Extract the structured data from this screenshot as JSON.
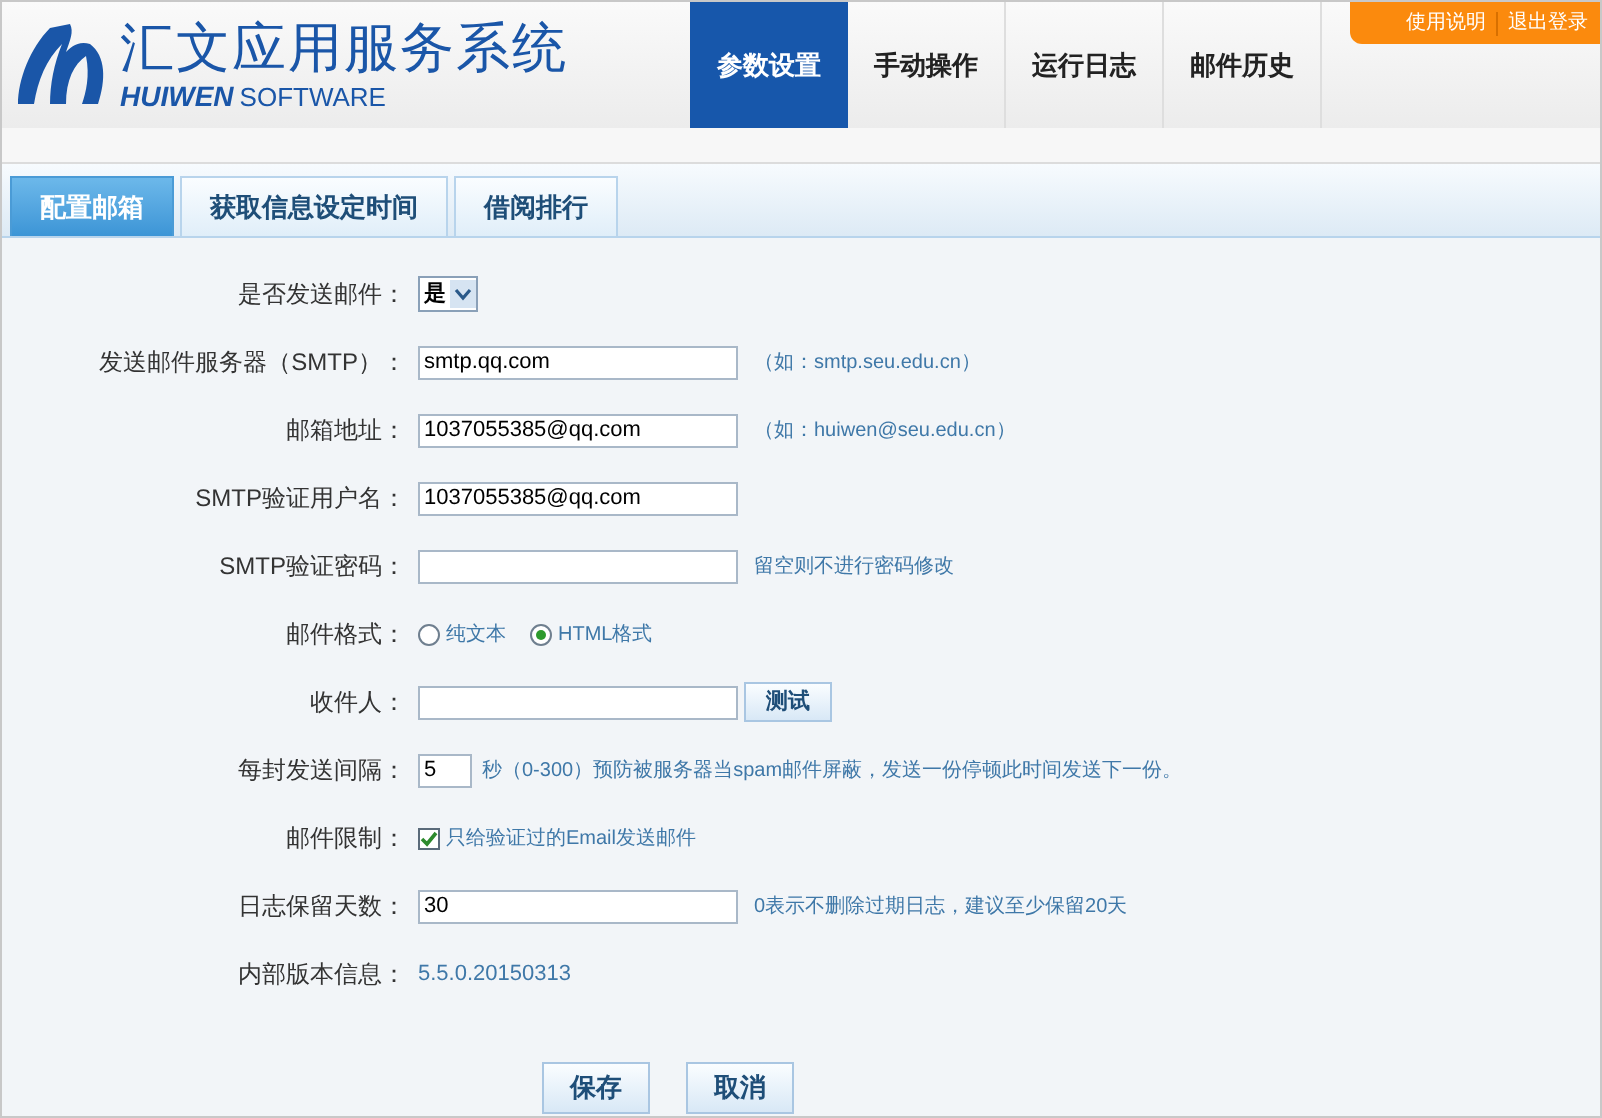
{
  "header": {
    "logo": {
      "title": "汇文应用服务系统",
      "brand": "HUIWEN",
      "subtitle": "SOFTWARE"
    },
    "nav": [
      {
        "label": "参数设置",
        "selected": true
      },
      {
        "label": "手动操作",
        "selected": false
      },
      {
        "label": "运行日志",
        "selected": false
      },
      {
        "label": "邮件历史",
        "selected": false
      }
    ],
    "top_links": [
      "使用说明",
      "退出登录"
    ]
  },
  "tabs": [
    {
      "label": "配置邮箱",
      "selected": true
    },
    {
      "label": "获取信息设定时间",
      "selected": false
    },
    {
      "label": "借阅排行",
      "selected": false
    }
  ],
  "form": {
    "rows": [
      {
        "kind": "select",
        "label": "是否发送邮件：",
        "value": "是"
      },
      {
        "kind": "text",
        "label": "发送邮件服务器（SMTP）：",
        "value": "smtp.qq.com",
        "hint": "（如：smtp.seu.edu.cn）"
      },
      {
        "kind": "text",
        "label": "邮箱地址：",
        "value": "1037055385@qq.com",
        "hint": "（如：huiwen@seu.edu.cn）"
      },
      {
        "kind": "text",
        "label": "SMTP验证用户名：",
        "value": "1037055385@qq.com"
      },
      {
        "kind": "text",
        "label": "SMTP验证密码：",
        "value": "",
        "hint": "留空则不进行密码修改"
      },
      {
        "kind": "radio",
        "label": "邮件格式：",
        "options": [
          {
            "label": "纯文本",
            "selected": false
          },
          {
            "label": "HTML格式",
            "selected": true
          }
        ]
      },
      {
        "kind": "text",
        "label": "收件人：",
        "value": "",
        "button": "测试"
      },
      {
        "kind": "short",
        "label": "每封发送间隔：",
        "value": "5",
        "hint": "秒（0-300）预防被服务器当spam邮件屏蔽，发送一份停顿此时间发送下一份。"
      },
      {
        "kind": "checkbox",
        "label": "邮件限制：",
        "checked": true,
        "text": "只给验证过的Email发送邮件"
      },
      {
        "kind": "text",
        "label": "日志保留天数：",
        "value": "30",
        "hint": "0表示不删除过期日志，建议至少保留20天"
      },
      {
        "kind": "info",
        "label": "内部版本信息：",
        "value": "5.5.0.20150313"
      }
    ]
  },
  "buttons": [
    "保存",
    "取消"
  ]
}
